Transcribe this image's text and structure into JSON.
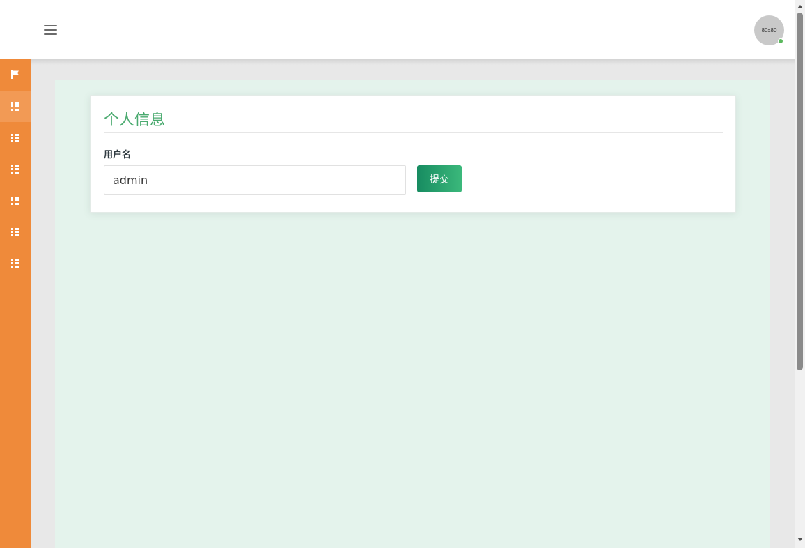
{
  "header": {
    "avatar_text": "80x80",
    "avatar_status_color": "#5bb85d"
  },
  "sidebar": {
    "color": "#ef8a3a",
    "items": [
      {
        "icon": "flag-icon"
      },
      {
        "icon": "grid-icon",
        "active": true
      },
      {
        "icon": "grid-icon"
      },
      {
        "icon": "grid-icon"
      },
      {
        "icon": "grid-icon"
      },
      {
        "icon": "grid-icon"
      },
      {
        "icon": "grid-icon"
      }
    ]
  },
  "card": {
    "title": "个人信息",
    "username_label": "用户名",
    "username_value": "admin",
    "submit_label": "提交"
  },
  "colors": {
    "title_green": "#4aaa6f",
    "button_gradient_start": "#178c61",
    "button_gradient_end": "#3bb87b",
    "panel_bg": "#e4f3ec"
  }
}
